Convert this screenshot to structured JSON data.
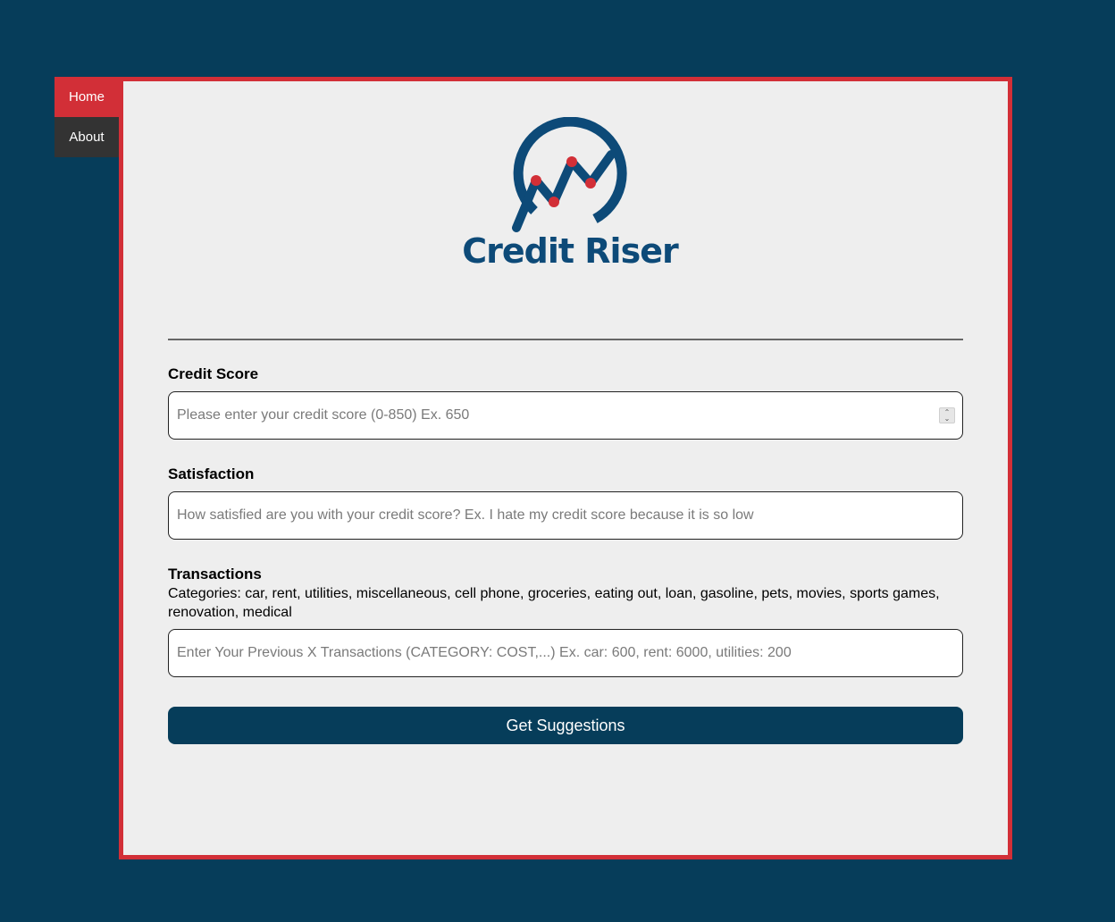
{
  "nav": {
    "items": [
      {
        "label": "Home",
        "active": true
      },
      {
        "label": "About",
        "active": false
      }
    ]
  },
  "colors": {
    "background": "#063d5a",
    "accent": "#d22f37",
    "nav_inactive": "#333333",
    "panel": "#eeeeee",
    "brand": "#0d4a78",
    "logo_dots": "#d22f37",
    "button": "#063d5a"
  },
  "logo": {
    "icon": "chart-trend-circle-icon",
    "text": "Credit Riser"
  },
  "form": {
    "credit_score": {
      "label": "Credit Score",
      "value": "",
      "placeholder": "Please enter your credit score (0-850) Ex. 650",
      "spinner_icon": "stepper-chevrons-icon"
    },
    "satisfaction": {
      "label": "Satisfaction",
      "value": "",
      "placeholder": "How satisfied are you with your credit score? Ex. I hate my credit score because it is so low"
    },
    "transactions": {
      "label": "Transactions",
      "categories_text": "Categories: car, rent, utilities, miscellaneous, cell phone, groceries, eating out, loan, gasoline, pets, movies, sports games, renovation, medical",
      "value": "",
      "placeholder": "Enter Your Previous X Transactions (CATEGORY: COST,...) Ex. car: 600, rent: 6000, utilities: 200"
    },
    "submit_label": "Get Suggestions"
  }
}
